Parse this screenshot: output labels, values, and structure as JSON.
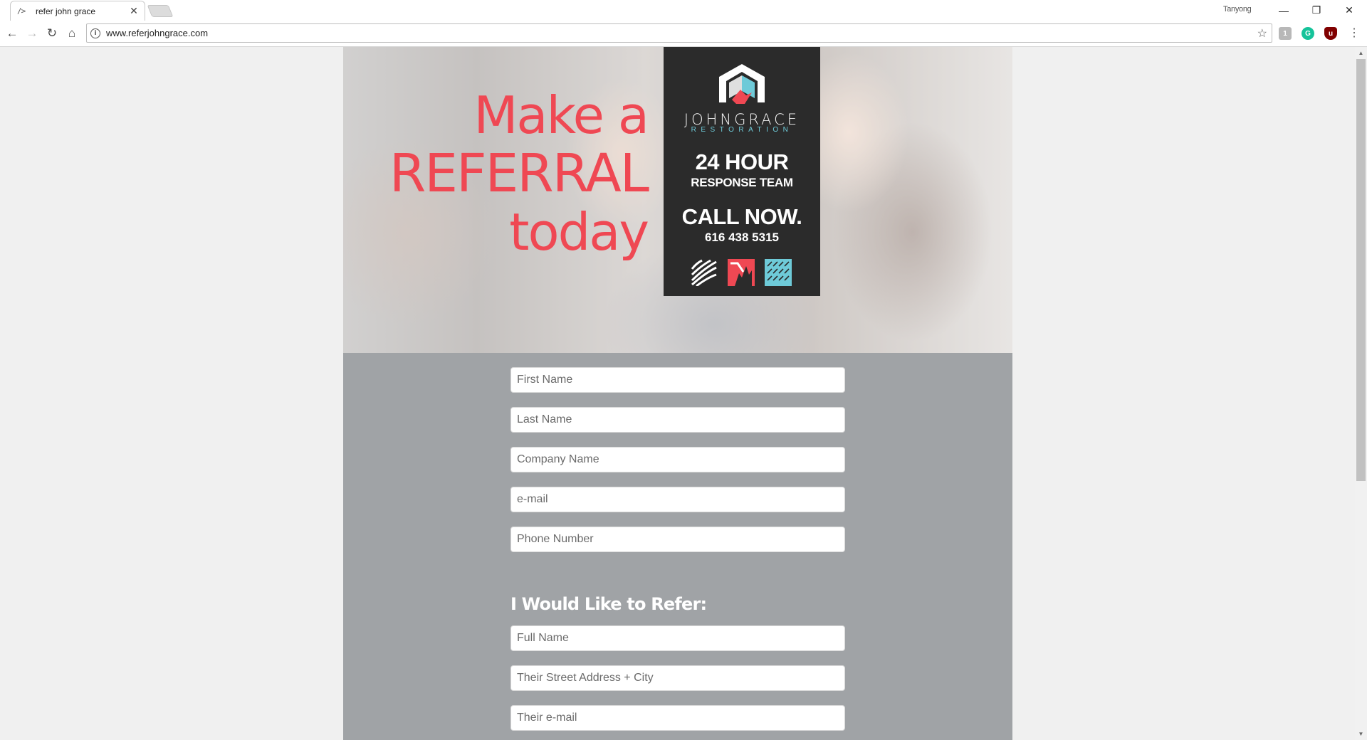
{
  "browser": {
    "tab_title": "refer john grace",
    "tab_favicon": "/>",
    "profile_name": "Tanyong",
    "url": "www.referjohngrace.com",
    "extensions": [
      {
        "icon": "extension-icon",
        "letter": "1",
        "color": "#b8b8b8"
      },
      {
        "icon": "grammarly-icon",
        "letter": "G",
        "color": "#15c39a"
      },
      {
        "icon": "ublock-icon",
        "letter": "u",
        "color": "#800000"
      }
    ]
  },
  "hero": {
    "headline": [
      "Make a",
      "REFERRAL",
      "today"
    ],
    "accent_color": "#ef4853",
    "promo": {
      "brand": "JOHNGRACE",
      "brand_sub": "RESTORATION",
      "hours": "24 HOUR",
      "team": "RESPONSE TEAM",
      "call": "CALL NOW.",
      "phone": "616 438 5315"
    }
  },
  "form": {
    "fields": [
      {
        "name": "first-name-field",
        "placeholder": "First Name"
      },
      {
        "name": "last-name-field",
        "placeholder": "Last Name"
      },
      {
        "name": "company-name-field",
        "placeholder": "Company Name"
      },
      {
        "name": "email-field",
        "placeholder": "e-mail"
      },
      {
        "name": "phone-number-field",
        "placeholder": "Phone Number"
      }
    ],
    "refer_heading": "I Would Like to Refer:",
    "refer_fields": [
      {
        "name": "referral-full-name-field",
        "placeholder": "Full Name"
      },
      {
        "name": "referral-address-field",
        "placeholder": "Their Street Address + City"
      },
      {
        "name": "referral-email-field",
        "placeholder": "Their e-mail"
      }
    ]
  }
}
